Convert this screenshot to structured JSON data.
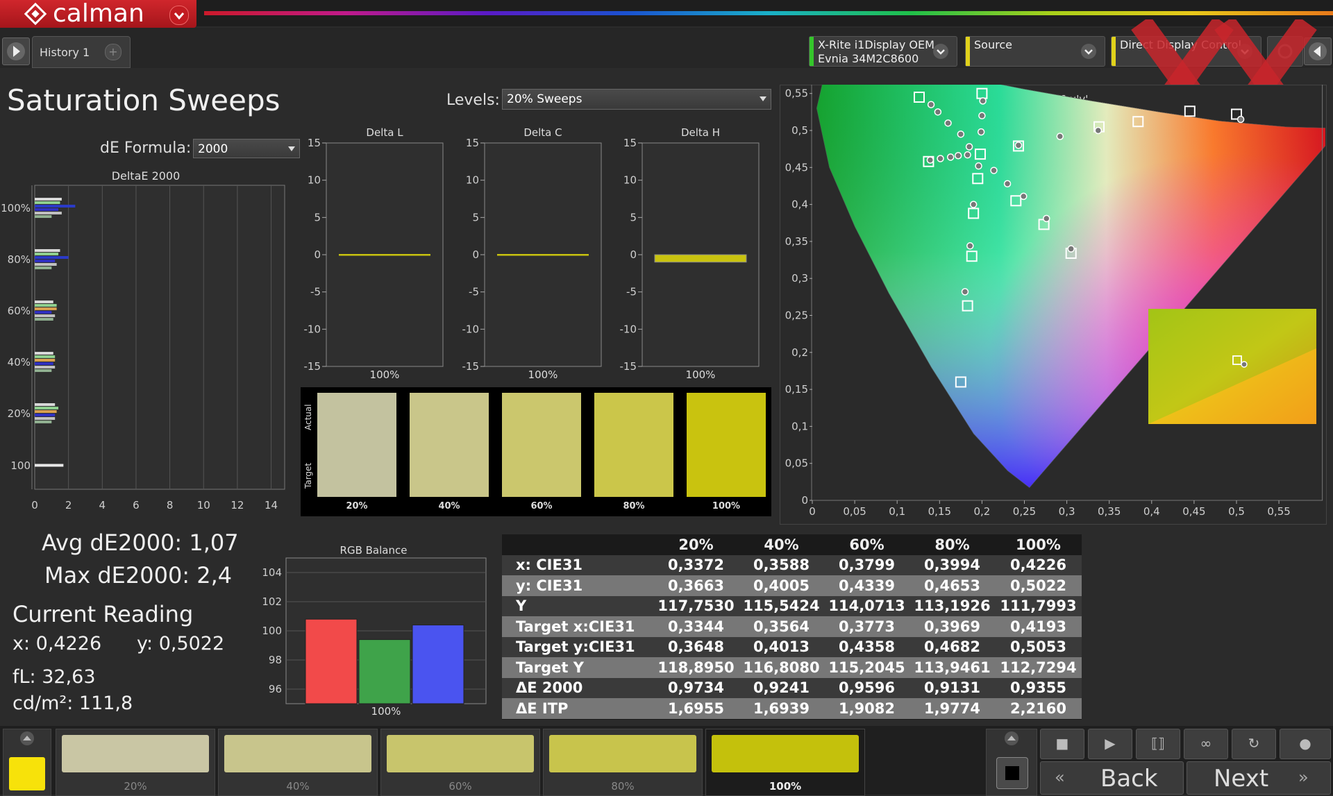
{
  "app": {
    "logo_text": "calman"
  },
  "tabs": {
    "history_label": "History 1",
    "add_label": "+"
  },
  "devices": [
    {
      "line1": "X-Rite i1Display OEM",
      "line2": "Evnia 34M2C8600",
      "color": "#35c62b"
    },
    {
      "line1": "Source",
      "line2": "",
      "color": "#e1d21b"
    },
    {
      "line1": "Direct Display Control",
      "line2": "",
      "color": "#e1d21b"
    }
  ],
  "page": {
    "title": "Saturation Sweeps",
    "levels_label": "Levels:",
    "levels_value": "20% Sweeps",
    "de_formula_label": "dE Formula:",
    "de_formula_value": "2000"
  },
  "deltae_chart": {
    "title": "DeltaE 2000",
    "x_ticks": [
      "0",
      "2",
      "4",
      "6",
      "8",
      "10",
      "12",
      "14"
    ],
    "y_labels": [
      "100%",
      "80%",
      "60%",
      "40%",
      "20%",
      "100"
    ],
    "groups": [
      {
        "label": "100%",
        "values": [
          1.6,
          1.5,
          2.4,
          1.4,
          1.6,
          1.0
        ]
      },
      {
        "label": "80%",
        "values": [
          1.5,
          1.4,
          2.0,
          1.2,
          1.3,
          1.0
        ]
      },
      {
        "label": "60%",
        "values": [
          1.1,
          1.3,
          1.3,
          1.0,
          1.2,
          1.1
        ]
      },
      {
        "label": "40%",
        "values": [
          1.1,
          1.2,
          1.2,
          1.1,
          1.2,
          1.0
        ]
      },
      {
        "label": "20%",
        "values": [
          1.2,
          1.4,
          1.3,
          1.2,
          1.2,
          1.0
        ]
      },
      {
        "label": "100",
        "values": [
          1.7
        ]
      }
    ]
  },
  "delta_charts": [
    {
      "title": "Delta L",
      "value": 0.0,
      "xlabel": "100%"
    },
    {
      "title": "Delta C",
      "value": 0.0,
      "xlabel": "100%"
    },
    {
      "title": "Delta H",
      "value": -1.0,
      "xlabel": "100%"
    }
  ],
  "delta_ticks": [
    "15",
    "10",
    "5",
    "0",
    "-5",
    "-10",
    "-15"
  ],
  "swatches": {
    "actual_label": "Actual",
    "target_label": "Target",
    "items": [
      {
        "label": "20%",
        "color": "#c3c29f"
      },
      {
        "label": "40%",
        "color": "#c9c68a"
      },
      {
        "label": "60%",
        "color": "#cbc76d"
      },
      {
        "label": "80%",
        "color": "#cbc64a"
      },
      {
        "label": "100%",
        "color": "#c9c30f"
      }
    ]
  },
  "cie": {
    "title": "CIE 1976 u'v'",
    "x_ticks": [
      "0",
      "0,05",
      "0,1",
      "0,15",
      "0,2",
      "0,25",
      "0,3",
      "0,35",
      "0,4",
      "0,45",
      "0,5",
      "0,55"
    ],
    "y_ticks": [
      "0",
      "0,05",
      "0,1",
      "0,15",
      "0,2",
      "0,25",
      "0,3",
      "0,35",
      "0,4",
      "0,45",
      "0,5",
      "0,55"
    ]
  },
  "stats": {
    "avg": "Avg dE2000: 1,07",
    "max": "Max dE2000: 2,4",
    "current_reading": "Current Reading",
    "x": "x: 0,4226",
    "y": "y: 0,5022",
    "fl": "fL: 32,63",
    "cdm2": "cd/m²: 111,8"
  },
  "rgb_balance": {
    "title": "RGB Balance",
    "y_ticks": [
      "104",
      "102",
      "100",
      "98",
      "96"
    ],
    "xlabel": "100%",
    "values": {
      "red": 100.8,
      "green": 99.4,
      "blue": 100.4
    },
    "colors": {
      "red": "#f24a4a",
      "green": "#3fa34a",
      "blue": "#4a54f0"
    }
  },
  "table": {
    "headers": [
      "",
      "20%",
      "40%",
      "60%",
      "80%",
      "100%"
    ],
    "rows": [
      [
        "x: CIE31",
        "0,3372",
        "0,3588",
        "0,3799",
        "0,3994",
        "0,4226"
      ],
      [
        "y: CIE31",
        "0,3663",
        "0,4005",
        "0,4339",
        "0,4653",
        "0,5022"
      ],
      [
        "Y",
        "117,7530",
        "115,5424",
        "114,0713",
        "113,1926",
        "111,7993"
      ],
      [
        "Target x:CIE31",
        "0,3344",
        "0,3564",
        "0,3773",
        "0,3969",
        "0,4193"
      ],
      [
        "Target y:CIE31",
        "0,3648",
        "0,4013",
        "0,4358",
        "0,4682",
        "0,5053"
      ],
      [
        "Target Y",
        "118,8950",
        "116,8080",
        "115,2045",
        "113,9461",
        "112,7294"
      ],
      [
        "ΔE 2000",
        "0,9734",
        "0,9241",
        "0,9596",
        "0,9131",
        "0,9355"
      ],
      [
        "ΔE ITP",
        "1,6955",
        "1,6939",
        "1,9082",
        "1,9774",
        "2,2160"
      ]
    ]
  },
  "bottom": {
    "current_color": "#f7e20a",
    "tiles": [
      {
        "label": "20%",
        "color": "#c9c6a4"
      },
      {
        "label": "40%",
        "color": "#c8c58c"
      },
      {
        "label": "60%",
        "color": "#c8c56c"
      },
      {
        "label": "80%",
        "color": "#c8c44c"
      },
      {
        "label": "100%",
        "color": "#c4c10c"
      }
    ],
    "back_label": "Back",
    "next_label": "Next"
  }
}
